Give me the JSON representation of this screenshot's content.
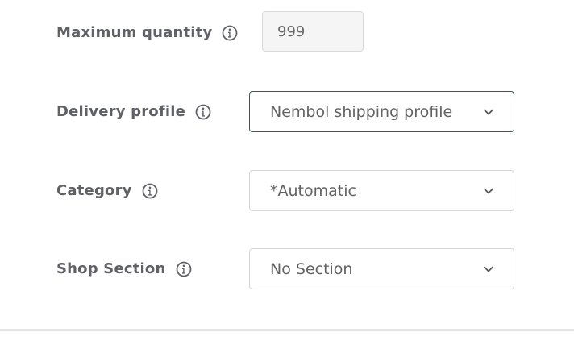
{
  "fields": {
    "max_quantity": {
      "label": "Maximum quantity",
      "value": "999",
      "info_icon": "info-icon"
    },
    "delivery_profile": {
      "label": "Delivery profile",
      "selected": "Nembol shipping profile",
      "info_icon": "info-icon"
    },
    "category": {
      "label": "Category",
      "selected": "*Automatic",
      "info_icon": "info-icon"
    },
    "shop_section": {
      "label": "Shop Section",
      "selected": "No Section",
      "info_icon": "info-icon"
    }
  },
  "colors": {
    "label": "#5f6166",
    "focused_border": "#2f5a66",
    "input_bg": "#f5f5f5"
  }
}
